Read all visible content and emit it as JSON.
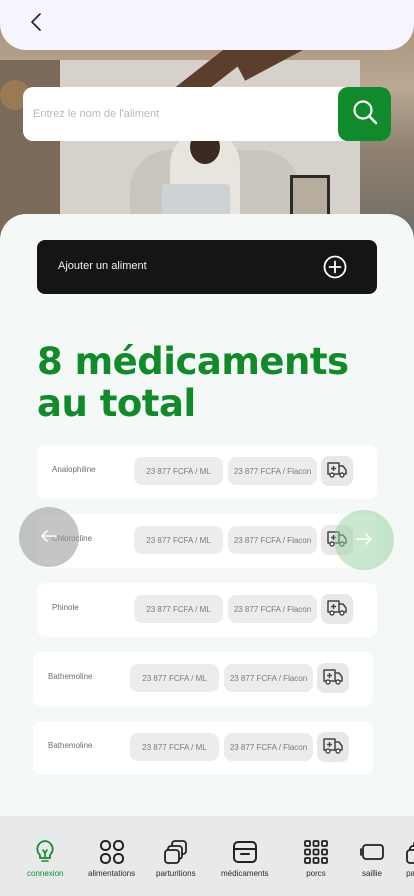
{
  "header": {
    "back_icon": "chevron-left-icon"
  },
  "search": {
    "placeholder": "Entrez le nom de l'aliment",
    "icon": "search-icon"
  },
  "actions": {
    "add_label": "Ajouter un aliment",
    "add_icon": "plus-circle-icon"
  },
  "summary": {
    "title": "8 médicaments au total"
  },
  "medications": [
    {
      "name": "Analophiline",
      "price_ml": "23 877 FCFA / ML",
      "price_flacon": "23 877 FCFA / Flacon"
    },
    {
      "name": "Chlorocline",
      "price_ml": "23 877 FCFA / ML",
      "price_flacon": "23 877 FCFA / Flacon"
    },
    {
      "name": "Phinole",
      "price_ml": "23 877 FCFA / ML",
      "price_flacon": "23 877 FCFA / Flacon"
    },
    {
      "name": "Bathemoline",
      "price_ml": "23 877 FCFA / ML",
      "price_flacon": "23 877 FCFA / Flacon"
    },
    {
      "name": "Bathemoline",
      "price_ml": "23 877 FCFA / ML",
      "price_flacon": "23 877 FCFA / Flacon"
    }
  ],
  "bottom_nav": [
    {
      "label": "connexion",
      "icon": "lightbulb-icon",
      "active": true
    },
    {
      "label": "alimentations",
      "icon": "grid-circles-icon"
    },
    {
      "label": "parturitions",
      "icon": "cards-stack-icon"
    },
    {
      "label": "médicaments",
      "icon": "archive-box-icon"
    },
    {
      "label": "porcs",
      "icon": "dots-grid-icon"
    },
    {
      "label": "saillie",
      "icon": "battery-icon"
    },
    {
      "label": "part",
      "icon": "cards-stack-icon"
    }
  ],
  "colors": {
    "accent": "#108a2b",
    "dark_button": "#151515"
  }
}
